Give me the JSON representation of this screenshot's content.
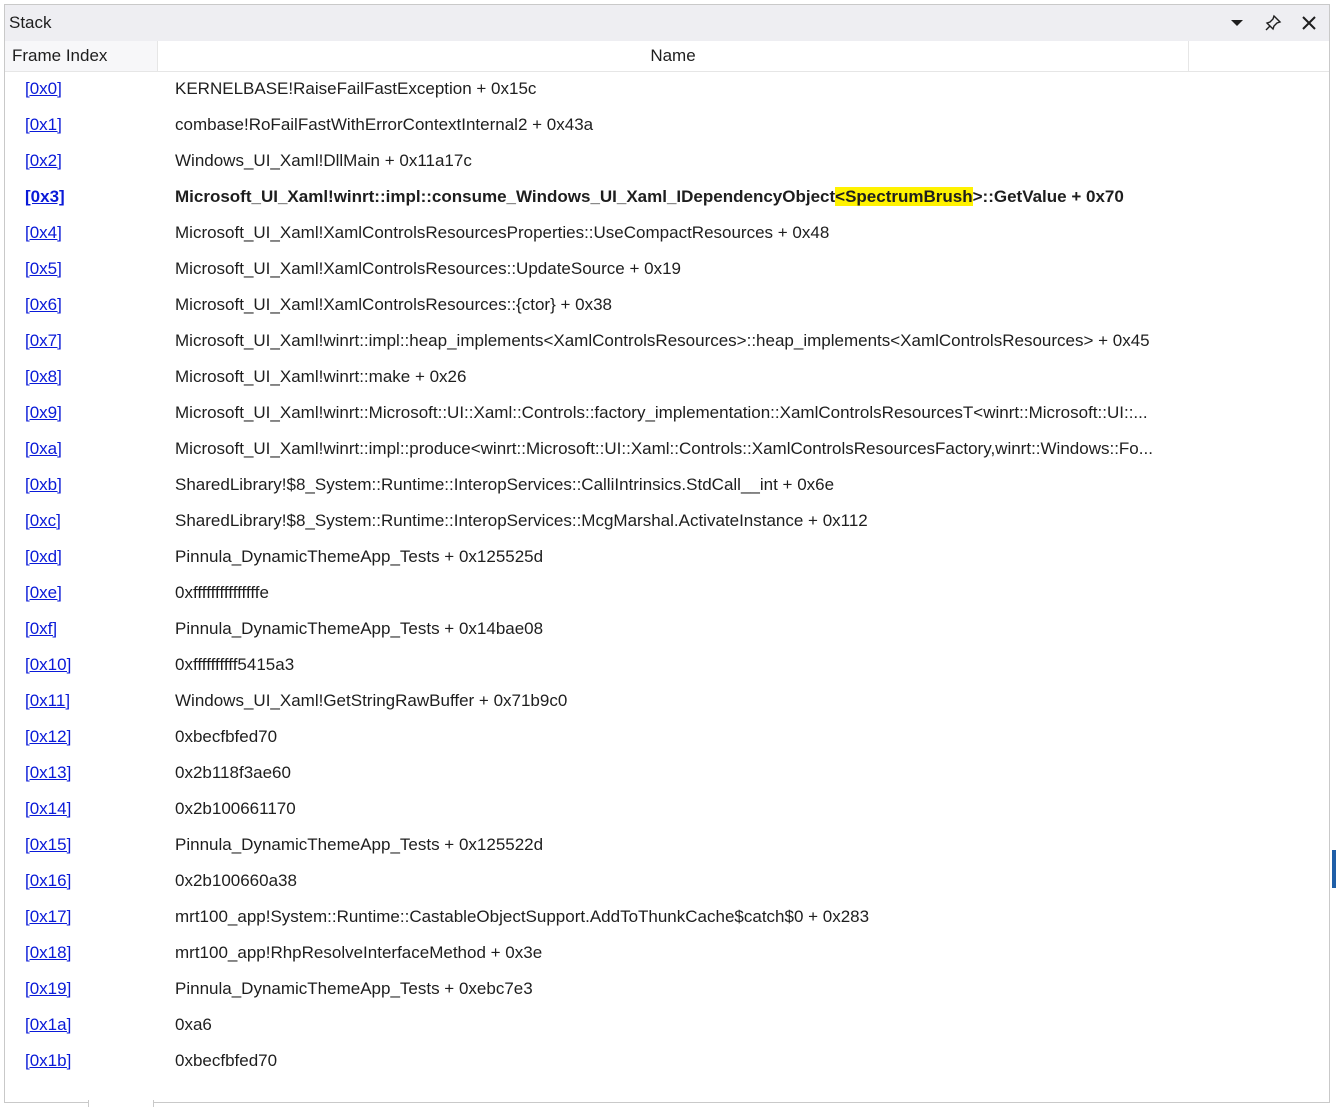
{
  "panel": {
    "title": "Stack"
  },
  "columns": {
    "frame_index": "Frame Index",
    "name": "Name"
  },
  "icons": {
    "dropdown": "chevron-down-icon",
    "pin": "pin-icon",
    "close": "close-icon"
  },
  "colors": {
    "link": "#0a1ad8",
    "highlight": "#fff200",
    "titlebar": "#eeeef2"
  },
  "frames": [
    {
      "index": "[0x0]",
      "name": "KERNELBASE!RaiseFailFastException + 0x15c"
    },
    {
      "index": "[0x1]",
      "name": "combase!RoFailFastWithErrorContextInternal2 + 0x43a"
    },
    {
      "index": "[0x2]",
      "name": "Windows_UI_Xaml!DllMain + 0x11a17c"
    },
    {
      "index": "[0x3]",
      "name_prefix": "Microsoft_UI_Xaml!winrt::impl::consume_Windows_UI_Xaml_IDependencyObject",
      "name_highlight": "<SpectrumBrush",
      "name_suffix": ">::GetValue + 0x70"
    },
    {
      "index": "[0x4]",
      "name": "Microsoft_UI_Xaml!XamlControlsResourcesProperties::UseCompactResources + 0x48"
    },
    {
      "index": "[0x5]",
      "name": "Microsoft_UI_Xaml!XamlControlsResources::UpdateSource + 0x19"
    },
    {
      "index": "[0x6]",
      "name": "Microsoft_UI_Xaml!XamlControlsResources::{ctor} + 0x38"
    },
    {
      "index": "[0x7]",
      "name": "Microsoft_UI_Xaml!winrt::impl::heap_implements<XamlControlsResources>::heap_implements<XamlControlsResources> + 0x45"
    },
    {
      "index": "[0x8]",
      "name": "Microsoft_UI_Xaml!winrt::make + 0x26"
    },
    {
      "index": "[0x9]",
      "name": "Microsoft_UI_Xaml!winrt::Microsoft::UI::Xaml::Controls::factory_implementation::XamlControlsResourcesT<winrt::Microsoft::UI::..."
    },
    {
      "index": "[0xa]",
      "name": "Microsoft_UI_Xaml!winrt::impl::produce<winrt::Microsoft::UI::Xaml::Controls::XamlControlsResourcesFactory,winrt::Windows::Fo..."
    },
    {
      "index": "[0xb]",
      "name": "SharedLibrary!$8_System::Runtime::InteropServices::CalliIntrinsics.StdCall__int + 0x6e"
    },
    {
      "index": "[0xc]",
      "name": "SharedLibrary!$8_System::Runtime::InteropServices::McgMarshal.ActivateInstance + 0x112"
    },
    {
      "index": "[0xd]",
      "name": "Pinnula_DynamicThemeApp_Tests + 0x125525d"
    },
    {
      "index": "[0xe]",
      "name": "0xfffffffffffffffe"
    },
    {
      "index": "[0xf]",
      "name": "Pinnula_DynamicThemeApp_Tests + 0x14bae08"
    },
    {
      "index": "[0x10]",
      "name": "0xffffffffff5415a3"
    },
    {
      "index": "[0x11]",
      "name": "Windows_UI_Xaml!GetStringRawBuffer + 0x71b9c0"
    },
    {
      "index": "[0x12]",
      "name": "0xbecfbfed70"
    },
    {
      "index": "[0x13]",
      "name": "0x2b118f3ae60"
    },
    {
      "index": "[0x14]",
      "name": "0x2b100661170"
    },
    {
      "index": "[0x15]",
      "name": "Pinnula_DynamicThemeApp_Tests + 0x125522d"
    },
    {
      "index": "[0x16]",
      "name": "0x2b100660a38"
    },
    {
      "index": "[0x17]",
      "name": "mrt100_app!System::Runtime::CastableObjectSupport.AddToThunkCache$catch$0 + 0x283"
    },
    {
      "index": "[0x18]",
      "name": "mrt100_app!RhpResolveInterfaceMethod + 0x3e"
    },
    {
      "index": "[0x19]",
      "name": "Pinnula_DynamicThemeApp_Tests + 0xebc7e3"
    },
    {
      "index": "[0x1a]",
      "name": "0xa6"
    },
    {
      "index": "[0x1b]",
      "name": "0xbecfbfed70"
    }
  ]
}
